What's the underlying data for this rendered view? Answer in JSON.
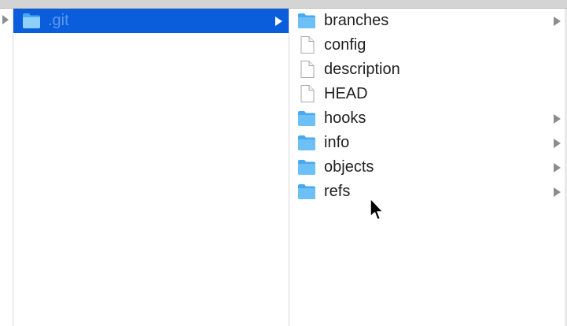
{
  "column1": {
    "items": [
      {
        "label": ".git",
        "type": "folder",
        "selected": true,
        "has_children": true
      }
    ]
  },
  "column2": {
    "items": [
      {
        "label": "branches",
        "type": "folder",
        "has_children": true
      },
      {
        "label": "config",
        "type": "file",
        "has_children": false
      },
      {
        "label": "description",
        "type": "file",
        "has_children": false
      },
      {
        "label": "HEAD",
        "type": "file",
        "has_children": false
      },
      {
        "label": "hooks",
        "type": "folder",
        "has_children": true
      },
      {
        "label": "info",
        "type": "folder",
        "has_children": true
      },
      {
        "label": "objects",
        "type": "folder",
        "has_children": true
      },
      {
        "label": "refs",
        "type": "folder",
        "has_children": true
      }
    ]
  },
  "colors": {
    "selection": "#0a5ddb",
    "selected_text": "#5b98f2",
    "folder": "#6cc0f5",
    "disclosure_arrow": "#8c8c8c"
  },
  "icons": {
    "folder": "folder-icon",
    "file": "document-icon",
    "disclosure": "disclosure-triangle-icon",
    "cursor": "mouse-pointer-icon"
  }
}
